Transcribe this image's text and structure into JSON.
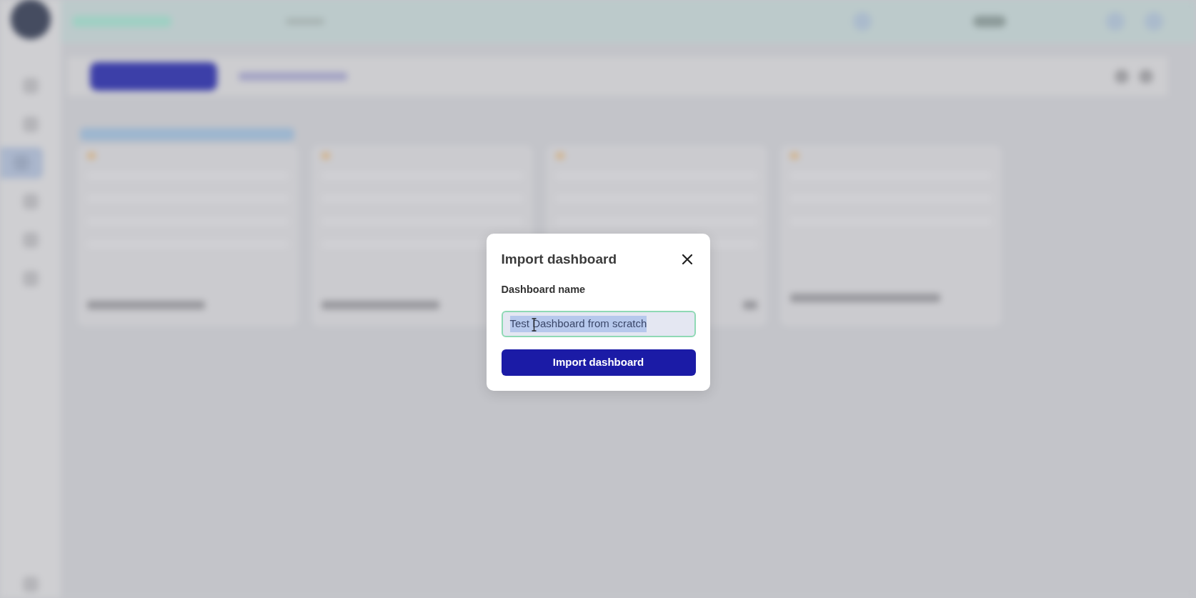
{
  "dialog": {
    "title": "Import dashboard",
    "field": {
      "label": "Dashboard name",
      "value": "Test Dashboard from scratch",
      "focused": true,
      "value_selected": true
    },
    "submit_button": {
      "label": "Import dashboard"
    }
  }
}
